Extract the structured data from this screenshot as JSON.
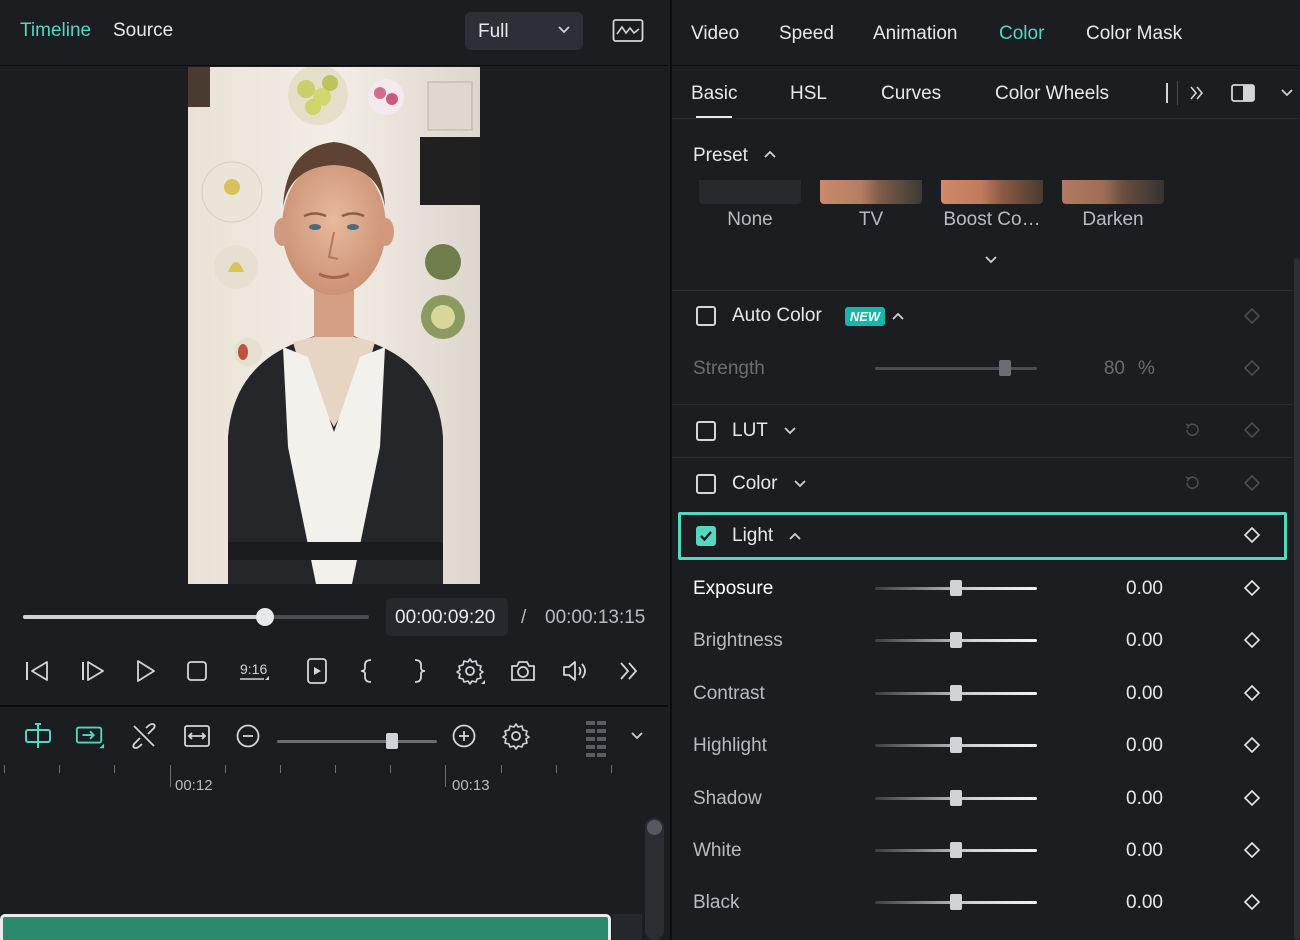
{
  "player": {
    "tabs": [
      "Timeline",
      "Source"
    ],
    "active_tab": "Timeline",
    "quality": "Full",
    "progress_fraction": 0.7,
    "current_time": "00:00:09:20",
    "time_separator": "/",
    "total_time": "00:00:13:15",
    "aspect_label": "9:16"
  },
  "timeline": {
    "zoom_fraction": 0.72,
    "ruler_labels": [
      "00:12",
      "00:13"
    ]
  },
  "panel": {
    "tabs": [
      "Video",
      "Speed",
      "Animation",
      "Color",
      "Color Mask"
    ],
    "active_tab": "Color",
    "subtabs": [
      "Basic",
      "HSL",
      "Curves",
      "Color Wheels"
    ],
    "active_subtab": "Basic",
    "preset": {
      "title": "Preset",
      "items": [
        "None",
        "TV",
        "Boost Co…",
        "Darken"
      ]
    },
    "auto_color": {
      "label": "Auto Color",
      "badge": "NEW",
      "checked": false,
      "strength_label": "Strength",
      "strength_value": "80",
      "strength_unit": "%",
      "strength_fraction": 0.8
    },
    "lut": {
      "label": "LUT",
      "checked": false
    },
    "color": {
      "label": "Color",
      "checked": false
    },
    "light": {
      "label": "Light",
      "checked": true,
      "params": [
        {
          "label": "Exposure",
          "value": "0.00"
        },
        {
          "label": "Brightness",
          "value": "0.00"
        },
        {
          "label": "Contrast",
          "value": "0.00"
        },
        {
          "label": "Highlight",
          "value": "0.00"
        },
        {
          "label": "Shadow",
          "value": "0.00"
        },
        {
          "label": "White",
          "value": "0.00"
        },
        {
          "label": "Black",
          "value": "0.00"
        }
      ]
    }
  },
  "colors": {
    "accent": "#55d6c0",
    "background": "#1b1d21",
    "badge": "#19b5a8",
    "clip": "#2a8a6e"
  }
}
